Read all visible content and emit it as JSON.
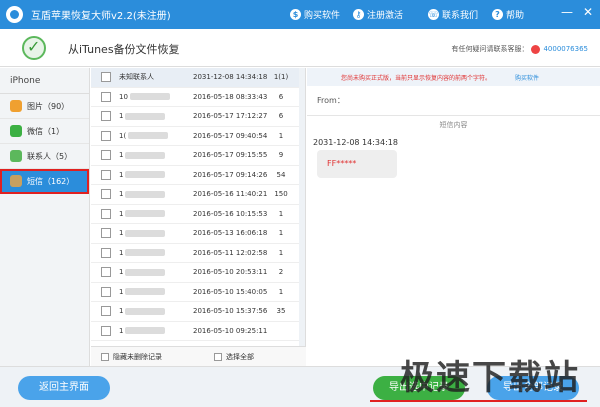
{
  "titlebar": {
    "title": "互盾苹果恢复大师v2.2(未注册)",
    "buy": "购买软件",
    "register": "注册激活",
    "contact": "联系我们",
    "help": "帮助",
    "min": "—",
    "close": "✕"
  },
  "header": {
    "title": "从iTunes备份文件恢复",
    "support_label": "有任何疑问请联系客服：",
    "support_qq": "4000076365"
  },
  "sidebar": {
    "device": "iPhone",
    "items": [
      {
        "label": "图片（90）",
        "color": "#f0a030"
      },
      {
        "label": "微信（1）",
        "color": "#3cb043"
      },
      {
        "label": "联系人（5）",
        "color": "#5cb85c"
      },
      {
        "label": "短信（162）",
        "color": "#c8a060"
      }
    ]
  },
  "list": {
    "rows": [
      {
        "name": "未知联系人",
        "date": "2031-12-08 14:34:18",
        "count": "1(1)"
      },
      {
        "name": "10",
        "date": "2016-05-18 08:33:43",
        "count": "6"
      },
      {
        "name": "1",
        "date": "2016-05-17 17:12:27",
        "count": "6"
      },
      {
        "name": "1(",
        "date": "2016-05-17 09:40:54",
        "count": "1"
      },
      {
        "name": "1",
        "date": "2016-05-17 09:15:55",
        "count": "9"
      },
      {
        "name": "1",
        "date": "2016-05-17 09:14:26",
        "count": "54"
      },
      {
        "name": "1",
        "date": "2016-05-16 11:40:21",
        "count": "150"
      },
      {
        "name": "1",
        "date": "2016-05-16 10:15:53",
        "count": "1"
      },
      {
        "name": "1",
        "date": "2016-05-13 16:06:18",
        "count": "1"
      },
      {
        "name": "1",
        "date": "2016-05-11 12:02:58",
        "count": "1"
      },
      {
        "name": "1",
        "date": "2016-05-10 20:53:11",
        "count": "2"
      },
      {
        "name": "1",
        "date": "2016-05-10 15:40:05",
        "count": "1"
      },
      {
        "name": "1",
        "date": "2016-05-10 15:37:56",
        "count": "35"
      },
      {
        "name": "1",
        "date": "2016-05-10 09:25:11",
        "count": ""
      }
    ],
    "hide_unremoved": "隐藏未删除记录",
    "select_all": "选择全部"
  },
  "detail": {
    "notice": "您尚未购买正式版，当前只显示恢复内容的前两个字符。",
    "buy_link": "购买软件",
    "from_label": "From：",
    "section_label": "短信内容",
    "msg_time": "2031-12-08 14:34:18",
    "msg_text": "FF*****"
  },
  "footer": {
    "back": "返回主界面",
    "export_selected": "导出选中记录",
    "export_all": "导出全部记录"
  },
  "watermark": "极速下载站"
}
